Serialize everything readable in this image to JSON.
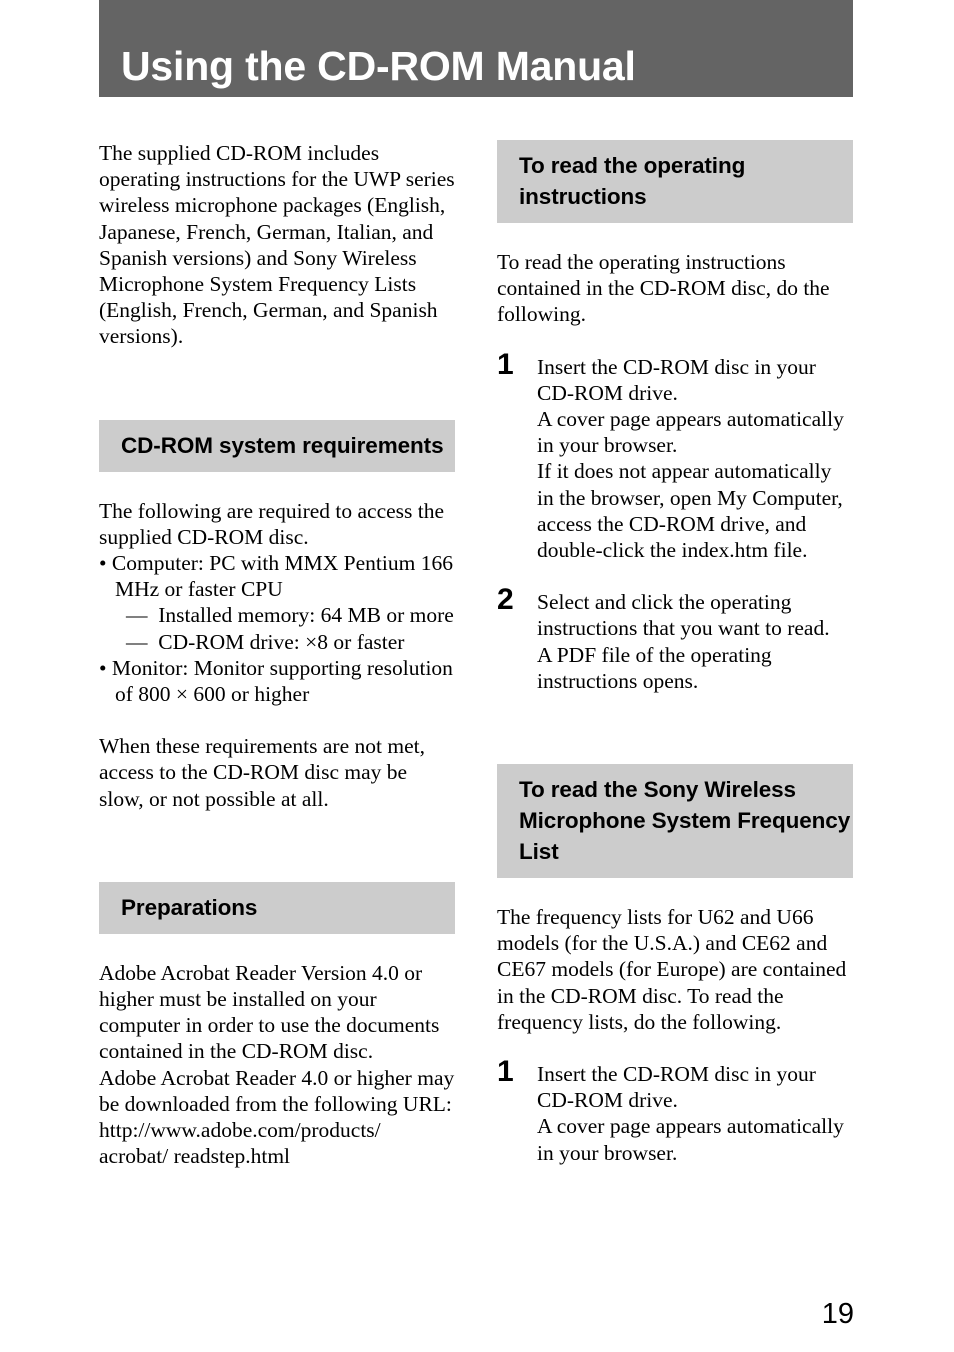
{
  "document": {
    "title": "Using the CD-ROM Manual",
    "page_number": "19",
    "colors": {
      "title_banner_bg": "#646464",
      "title_banner_text": "#ffffff",
      "section_band_bg": "#cccccc",
      "body_text": "#000000",
      "page_bg": "#ffffff"
    }
  },
  "left_column": {
    "intro_paragraph": "The supplied CD-ROM includes operating instructions for the UWP series wireless microphone packages (English, Japanese, French, German, Italian, and Spanish versions) and Sony Wireless Microphone System Frequency Lists (English, French, German, and Spanish versions).",
    "sections": [
      {
        "heading": "CD-ROM system requirements",
        "intro": "The following are required to access the supplied CD-ROM disc.",
        "bullets": [
          {
            "bullet": "•",
            "text": "Computer: PC with MMX Pentium 166 MHz or faster CPU"
          },
          {
            "dash": "—",
            "text": "Installed memory: 64 MB or more"
          },
          {
            "dash": "—",
            "text": "CD-ROM drive:  ×8 or faster"
          },
          {
            "bullet": "•",
            "text": "Monitor: Monitor supporting resolution of 800 × 600 or higher"
          }
        ],
        "note": "When these requirements are not met, access to the CD-ROM disc may be slow, or not possible at all."
      },
      {
        "heading": "Preparations",
        "paragraph_1": "Adobe Acrobat Reader Version 4.0 or higher must be installed on your computer in order to use the documents contained in the CD-ROM disc.",
        "paragraph_2": "Adobe Acrobat Reader 4.0 or higher may be downloaded from the following URL:",
        "url": "http://www.adobe.com/products/ acrobat/ readstep.html"
      }
    ]
  },
  "right_column": {
    "sections": [
      {
        "heading": "To read the operating instructions",
        "intro": "To read the operating instructions contained in the CD-ROM disc, do the following.",
        "steps": [
          {
            "number": "1",
            "lines": [
              "Insert the CD-ROM disc in your CD-ROM drive.",
              "A cover page appears automatically in your browser.",
              "If it does not appear automatically in the browser, open My Computer, access the CD-ROM drive, and double-click the index.htm file."
            ]
          },
          {
            "number": "2",
            "lines": [
              "Select and click the operating instructions that you want to read.",
              "A PDF file of the operating instructions opens."
            ]
          }
        ]
      },
      {
        "heading": "To read the Sony Wireless Microphone System Frequency List",
        "intro": "The frequency lists for U62 and U66 models (for the U.S.A.) and CE62 and CE67 models (for Europe) are contained in the CD-ROM disc.  To read the frequency lists, do the following.",
        "steps": [
          {
            "number": "1",
            "lines": [
              "Insert the CD-ROM disc in your CD-ROM drive.",
              "A cover page appears automatically in your browser."
            ]
          }
        ]
      }
    ]
  }
}
